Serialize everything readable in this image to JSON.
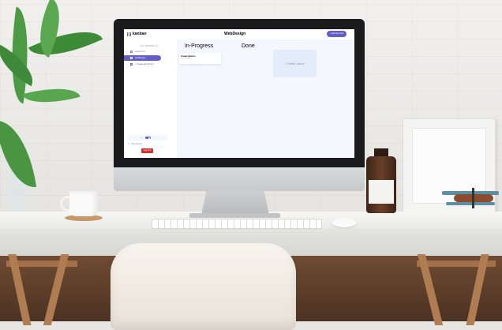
{
  "app": {
    "logo_text": "kanban",
    "board_title": "WebDesign",
    "add_task_label": "+ Add New Task"
  },
  "sidebar": {
    "heading": "ALL BOARDS (2)",
    "items": [
      {
        "label": "Dashboard"
      },
      {
        "label": "WebDesign"
      },
      {
        "label": "+ Create New Board"
      }
    ],
    "theme_toggle": {
      "light_icon": "☀",
      "dark_icon": "☾"
    },
    "hide_label": "Hide Sidebar",
    "logout_label": "Log Out"
  },
  "main": {
    "columns": [
      {
        "title": "In-Progress",
        "tasks": [
          {
            "title": "Create Button",
            "subtasks": "0 of 1 subtasks"
          }
        ]
      },
      {
        "title": "Done",
        "tasks": []
      }
    ],
    "new_column_label": "+ Create Column"
  },
  "colors": {
    "accent": "#635fc7",
    "danger": "#d3332e",
    "board_bg": "#f4f7fd"
  }
}
